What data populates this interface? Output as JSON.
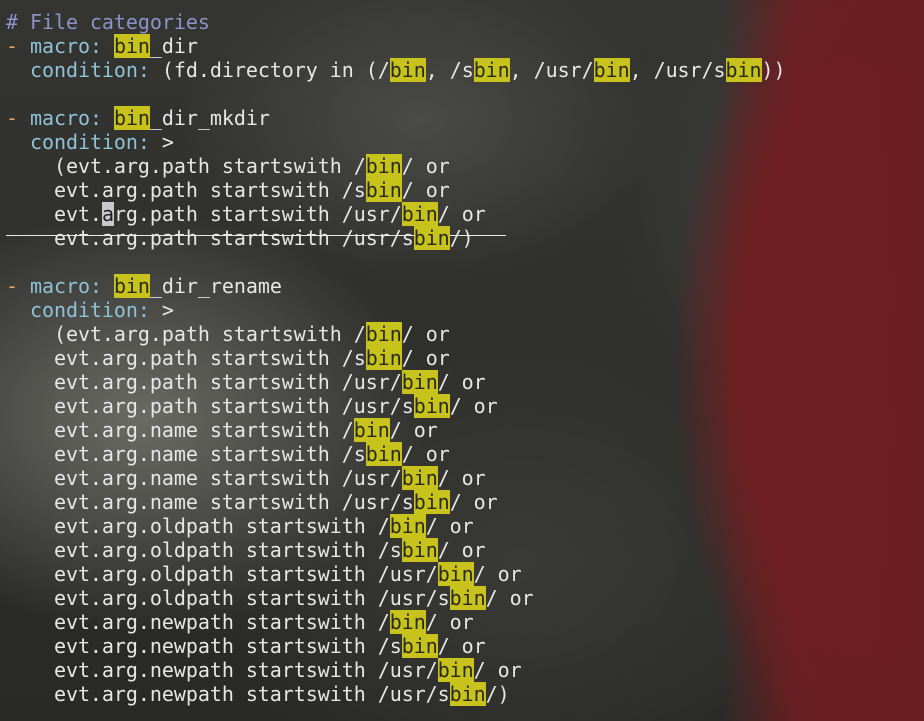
{
  "editor": {
    "lines": [
      [
        {
          "t": "# File categories",
          "c": "comment"
        }
      ],
      [
        {
          "t": "- ",
          "c": "dash"
        },
        {
          "t": "macro:",
          "c": "key"
        },
        {
          "t": " "
        },
        {
          "t": "bin",
          "c": "hl"
        },
        {
          "t": "_dir"
        }
      ],
      [
        {
          "t": "  "
        },
        {
          "t": "condition:",
          "c": "key"
        },
        {
          "t": " (fd.directory in (/"
        },
        {
          "t": "bin",
          "c": "hl"
        },
        {
          "t": ", /s"
        },
        {
          "t": "bin",
          "c": "hl"
        },
        {
          "t": ", /usr/"
        },
        {
          "t": "bin",
          "c": "hl"
        },
        {
          "t": ", /usr/s"
        },
        {
          "t": "bin",
          "c": "hl"
        },
        {
          "t": "))"
        }
      ],
      [
        {
          "t": ""
        }
      ],
      [
        {
          "t": "- ",
          "c": "dash"
        },
        {
          "t": "macro:",
          "c": "key"
        },
        {
          "t": " "
        },
        {
          "t": "bin",
          "c": "hl"
        },
        {
          "t": "_dir_mkdir"
        }
      ],
      [
        {
          "t": "  "
        },
        {
          "t": "condition:",
          "c": "key"
        },
        {
          "t": " >"
        }
      ],
      [
        {
          "t": "    (evt.arg.path startswith /"
        },
        {
          "t": "bin",
          "c": "hl"
        },
        {
          "t": "/ or"
        }
      ],
      [
        {
          "t": "    evt.arg.path startswith /s"
        },
        {
          "t": "bin",
          "c": "hl"
        },
        {
          "t": "/ or"
        }
      ],
      [
        {
          "t": "    evt."
        },
        {
          "t": "a",
          "c": "cursor"
        },
        {
          "t": "rg.path startswith /usr/"
        },
        {
          "t": "bin",
          "c": "hl"
        },
        {
          "t": "/ or"
        }
      ],
      [
        {
          "t": "    evt.arg.path startswith /usr/s"
        },
        {
          "t": "bin",
          "c": "hl"
        },
        {
          "t": "/)"
        }
      ],
      [
        {
          "t": ""
        }
      ],
      [
        {
          "t": "- ",
          "c": "dash"
        },
        {
          "t": "macro:",
          "c": "key"
        },
        {
          "t": " "
        },
        {
          "t": "bin",
          "c": "hl"
        },
        {
          "t": "_dir_rename"
        }
      ],
      [
        {
          "t": "  "
        },
        {
          "t": "condition:",
          "c": "key"
        },
        {
          "t": " >"
        }
      ],
      [
        {
          "t": "    (evt.arg.path startswith /"
        },
        {
          "t": "bin",
          "c": "hl"
        },
        {
          "t": "/ or"
        }
      ],
      [
        {
          "t": "    evt.arg.path startswith /s"
        },
        {
          "t": "bin",
          "c": "hl"
        },
        {
          "t": "/ or"
        }
      ],
      [
        {
          "t": "    evt.arg.path startswith /usr/"
        },
        {
          "t": "bin",
          "c": "hl"
        },
        {
          "t": "/ or"
        }
      ],
      [
        {
          "t": "    evt.arg.path startswith /usr/s"
        },
        {
          "t": "bin",
          "c": "hl"
        },
        {
          "t": "/ or"
        }
      ],
      [
        {
          "t": "    evt.arg.name startswith /"
        },
        {
          "t": "bin",
          "c": "hl"
        },
        {
          "t": "/ or"
        }
      ],
      [
        {
          "t": "    evt.arg.name startswith /s"
        },
        {
          "t": "bin",
          "c": "hl"
        },
        {
          "t": "/ or"
        }
      ],
      [
        {
          "t": "    evt.arg.name startswith /usr/"
        },
        {
          "t": "bin",
          "c": "hl"
        },
        {
          "t": "/ or"
        }
      ],
      [
        {
          "t": "    evt.arg.name startswith /usr/s"
        },
        {
          "t": "bin",
          "c": "hl"
        },
        {
          "t": "/ or"
        }
      ],
      [
        {
          "t": "    evt.arg.oldpath startswith /"
        },
        {
          "t": "bin",
          "c": "hl"
        },
        {
          "t": "/ or"
        }
      ],
      [
        {
          "t": "    evt.arg.oldpath startswith /s"
        },
        {
          "t": "bin",
          "c": "hl"
        },
        {
          "t": "/ or"
        }
      ],
      [
        {
          "t": "    evt.arg.oldpath startswith /usr/"
        },
        {
          "t": "bin",
          "c": "hl"
        },
        {
          "t": "/ or"
        }
      ],
      [
        {
          "t": "    evt.arg.oldpath startswith /usr/s"
        },
        {
          "t": "bin",
          "c": "hl"
        },
        {
          "t": "/ or"
        }
      ],
      [
        {
          "t": "    evt.arg.newpath startswith /"
        },
        {
          "t": "bin",
          "c": "hl"
        },
        {
          "t": "/ or"
        }
      ],
      [
        {
          "t": "    evt.arg.newpath startswith /s"
        },
        {
          "t": "bin",
          "c": "hl"
        },
        {
          "t": "/ or"
        }
      ],
      [
        {
          "t": "    evt.arg.newpath startswith /usr/"
        },
        {
          "t": "bin",
          "c": "hl"
        },
        {
          "t": "/ or"
        }
      ],
      [
        {
          "t": "    evt.arg.newpath startswith /usr/s"
        },
        {
          "t": "bin",
          "c": "hl"
        },
        {
          "t": "/)"
        }
      ]
    ]
  },
  "colors": {
    "comment": "#8a94c9",
    "dash": "#e8a15e",
    "key": "#8fc2d6",
    "text": "#e6e6e6",
    "search_highlight": "#c7c31c"
  }
}
